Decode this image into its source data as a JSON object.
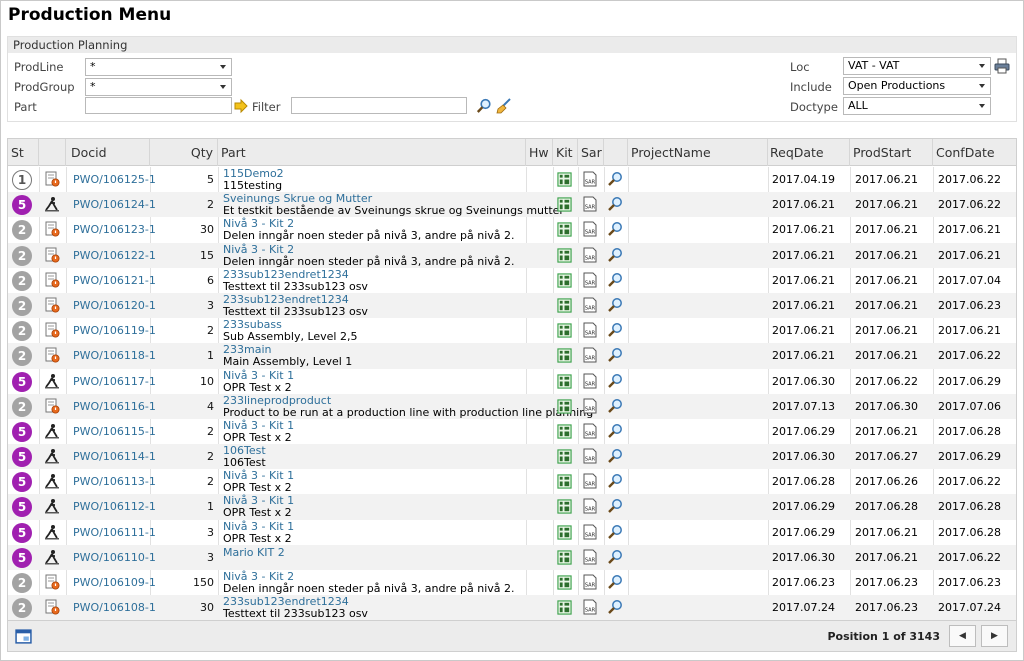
{
  "page": {
    "title": "Production Menu"
  },
  "panel": {
    "title": "Production Planning",
    "prodline": {
      "label": "ProdLine",
      "value": "*"
    },
    "prodgroup": {
      "label": "ProdGroup",
      "value": "*"
    },
    "part": {
      "label": "Part",
      "value": ""
    },
    "filter": {
      "label": "Filter",
      "value": ""
    },
    "loc": {
      "label": "Loc",
      "value": "VAT - VAT"
    },
    "include": {
      "label": "Include",
      "value": "Open Productions"
    },
    "doctype": {
      "label": "Doctype",
      "value": "ALL"
    }
  },
  "grid": {
    "columns": {
      "st": "St",
      "docid": "Docid",
      "qty": "Qty",
      "part": "Part",
      "hw": "Hw",
      "kit": "Kit",
      "sar": "Sar",
      "project": "ProjectName",
      "reqdate": "ReqDate",
      "prodstart": "ProdStart",
      "confdate": "ConfDate"
    },
    "rows": [
      {
        "status": "1",
        "docid": "PWO/106125-1",
        "qty": "5",
        "part": "115Demo2",
        "desc": "115testing",
        "req": "2017.04.19",
        "start": "2017.06.21",
        "conf": "2017.06.22",
        "type": "doc"
      },
      {
        "status": "5",
        "docid": "PWO/106124-1",
        "qty": "2",
        "part": "Sveinungs Skrue og Mutter",
        "desc": "Et testkit bestående av Sveinungs skrue og Sveinungs mutter",
        "req": "2017.06.21",
        "start": "2017.06.21",
        "conf": "2017.06.22",
        "type": "worker"
      },
      {
        "status": "2",
        "docid": "PWO/106123-1",
        "qty": "30",
        "part": "Nivå 3 - Kit 2",
        "desc": "Delen inngår noen steder på nivå 3, andre på nivå 2.",
        "req": "2017.06.21",
        "start": "2017.06.21",
        "conf": "2017.06.21",
        "type": "doc"
      },
      {
        "status": "2",
        "docid": "PWO/106122-1",
        "qty": "15",
        "part": "Nivå 3 - Kit 2",
        "desc": "Delen inngår noen steder på nivå 3, andre på nivå 2.",
        "req": "2017.06.21",
        "start": "2017.06.21",
        "conf": "2017.06.21",
        "type": "doc"
      },
      {
        "status": "2",
        "docid": "PWO/106121-1",
        "qty": "6",
        "part": "233sub123endret1234",
        "desc": "Testtext til 233sub123 osv",
        "req": "2017.06.21",
        "start": "2017.06.21",
        "conf": "2017.07.04",
        "type": "doc"
      },
      {
        "status": "2",
        "docid": "PWO/106120-1",
        "qty": "3",
        "part": "233sub123endret1234",
        "desc": "Testtext til 233sub123 osv",
        "req": "2017.06.21",
        "start": "2017.06.21",
        "conf": "2017.06.23",
        "type": "doc"
      },
      {
        "status": "2",
        "docid": "PWO/106119-1",
        "qty": "2",
        "part": "233subass",
        "desc": "Sub Assembly, Level 2,5",
        "req": "2017.06.21",
        "start": "2017.06.21",
        "conf": "2017.06.21",
        "type": "doc"
      },
      {
        "status": "2",
        "docid": "PWO/106118-1",
        "qty": "1",
        "part": "233main",
        "desc": "Main Assembly, Level 1",
        "req": "2017.06.21",
        "start": "2017.06.21",
        "conf": "2017.06.22",
        "type": "doc"
      },
      {
        "status": "5",
        "docid": "PWO/106117-1",
        "qty": "10",
        "part": "Nivå 3 - Kit 1",
        "desc": "OPR Test x 2",
        "req": "2017.06.30",
        "start": "2017.06.22",
        "conf": "2017.06.29",
        "type": "worker"
      },
      {
        "status": "2",
        "docid": "PWO/106116-1",
        "qty": "4",
        "part": "233lineprodproduct",
        "desc": "Product to be run at a production line with production line planning",
        "req": "2017.07.13",
        "start": "2017.06.30",
        "conf": "2017.07.06",
        "type": "doc"
      },
      {
        "status": "5",
        "docid": "PWO/106115-1",
        "qty": "2",
        "part": "Nivå 3 - Kit 1",
        "desc": "OPR Test x 2",
        "req": "2017.06.29",
        "start": "2017.06.21",
        "conf": "2017.06.28",
        "type": "worker"
      },
      {
        "status": "5",
        "docid": "PWO/106114-1",
        "qty": "2",
        "part": "106Test",
        "desc": "106Test",
        "req": "2017.06.30",
        "start": "2017.06.27",
        "conf": "2017.06.29",
        "type": "worker"
      },
      {
        "status": "5",
        "docid": "PWO/106113-1",
        "qty": "2",
        "part": "Nivå 3 - Kit 1",
        "desc": "OPR Test x 2",
        "req": "2017.06.28",
        "start": "2017.06.26",
        "conf": "2017.06.22",
        "type": "worker"
      },
      {
        "status": "5",
        "docid": "PWO/106112-1",
        "qty": "1",
        "part": "Nivå 3 - Kit 1",
        "desc": "OPR Test x 2",
        "req": "2017.06.29",
        "start": "2017.06.28",
        "conf": "2017.06.28",
        "type": "worker"
      },
      {
        "status": "5",
        "docid": "PWO/106111-1",
        "qty": "3",
        "part": "Nivå 3 - Kit 1",
        "desc": "OPR Test x 2",
        "req": "2017.06.29",
        "start": "2017.06.21",
        "conf": "2017.06.28",
        "type": "worker"
      },
      {
        "status": "5",
        "docid": "PWO/106110-1",
        "qty": "3",
        "part": "Mario KIT 2",
        "desc": "",
        "req": "2017.06.30",
        "start": "2017.06.21",
        "conf": "2017.06.22",
        "type": "worker"
      },
      {
        "status": "2",
        "docid": "PWO/106109-1",
        "qty": "150",
        "part": "Nivå 3 - Kit 2",
        "desc": "Delen inngår noen steder på nivå 3, andre på nivå 2.",
        "req": "2017.06.23",
        "start": "2017.06.23",
        "conf": "2017.06.23",
        "type": "doc"
      },
      {
        "status": "2",
        "docid": "PWO/106108-1",
        "qty": "30",
        "part": "233sub123endret1234",
        "desc": "Testtext til 233sub123 osv",
        "req": "2017.07.24",
        "start": "2017.06.23",
        "conf": "2017.07.24",
        "type": "doc"
      }
    ]
  },
  "footer": {
    "position_label": "Position",
    "position": "1",
    "of_label": "of",
    "total": "3143"
  },
  "colors": {
    "accent_link": "#2e6f9a",
    "status_purple": "#a020b0",
    "status_gray": "#a3a3a3",
    "kit_green": "#3aa04a"
  }
}
